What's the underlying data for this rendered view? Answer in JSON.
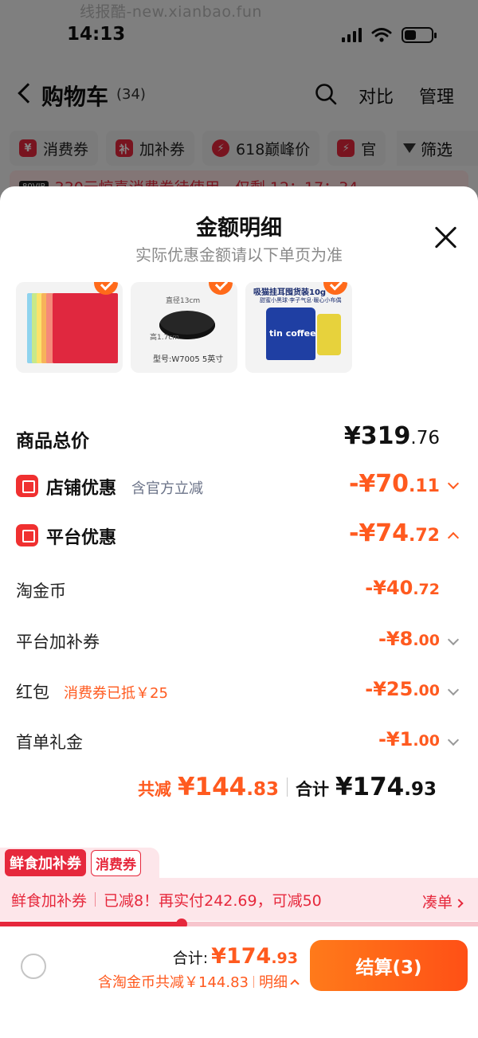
{
  "watermark": "线报酷-new.xianbao.fun",
  "status_bar": {
    "time": "14:13"
  },
  "background_page": {
    "nav": {
      "title": "购物车",
      "count": "(34)",
      "compare": "对比",
      "manage": "管理"
    },
    "chips": [
      {
        "badge": "¥",
        "label": "消费券"
      },
      {
        "badge": "补",
        "label": "加补券"
      },
      {
        "badge": "⚡",
        "label": "618巅峰价"
      },
      {
        "badge": "⚡",
        "label": "官"
      }
    ],
    "filter_label": "筛选",
    "promo_strip": {
      "tag": "80VIP",
      "text": "330元惊喜消费券待使用，仅剩 12：17：34"
    }
  },
  "sheet": {
    "title": "金额明细",
    "subtitle": "实际优惠金额请以下单页为准",
    "products": [
      {
        "name": "colored-paper"
      },
      {
        "name": "frying-pan",
        "label_diameter": "直径13cm",
        "label_height": "高1.7cm",
        "model": "型号:W7005  5英寸"
      },
      {
        "name": "coffee-pack",
        "headline": "吸猫挂耳囤货装10g",
        "sub": "甜蜜小黑球·李子气息·暖心小布偶",
        "bag_text": "tin coffee"
      }
    ],
    "total_price": {
      "label": "商品总价",
      "integer": "¥319",
      "decimal": ".76"
    },
    "store_discount": {
      "label": "店铺优惠",
      "note": "含官方立减",
      "integer": "-¥70",
      "decimal": ".11"
    },
    "platform_discount": {
      "label": "平台优惠",
      "integer": "-¥74",
      "decimal": ".72"
    },
    "items": [
      {
        "label": "淘金币",
        "note": "",
        "integer": "-¥40",
        "decimal": ".72"
      },
      {
        "label": "平台加补券",
        "note": "",
        "integer": "-¥8",
        "decimal": ".00"
      },
      {
        "label": "红包",
        "note": "消费券已抵￥25",
        "integer": "-¥25",
        "decimal": ".00"
      },
      {
        "label": "首单礼金",
        "note": "",
        "integer": "-¥1",
        "decimal": ".00"
      }
    ],
    "totals": {
      "saved_label": "共减",
      "saved_integer": "¥144",
      "saved_decimal": ".83",
      "total_label": "合计",
      "total_integer": "¥174",
      "total_decimal": ".93"
    }
  },
  "coupon": {
    "tab_active": "鲜食加补券",
    "tab_other": "消费券",
    "bar_title": "鲜食加补券",
    "bar_text": "已减8！再实付242.69，可减50",
    "action": "凑单",
    "progress_fraction": 0.38
  },
  "checkout": {
    "total_label": "合计:",
    "total_integer": "¥174",
    "total_decimal": ".93",
    "detail_text": "含淘金币共减￥144.83",
    "detail_link": "明细",
    "button_label": "结算(3)"
  },
  "colors": {
    "accent": "#ff5a1f",
    "brand_red": "#e6283c"
  }
}
